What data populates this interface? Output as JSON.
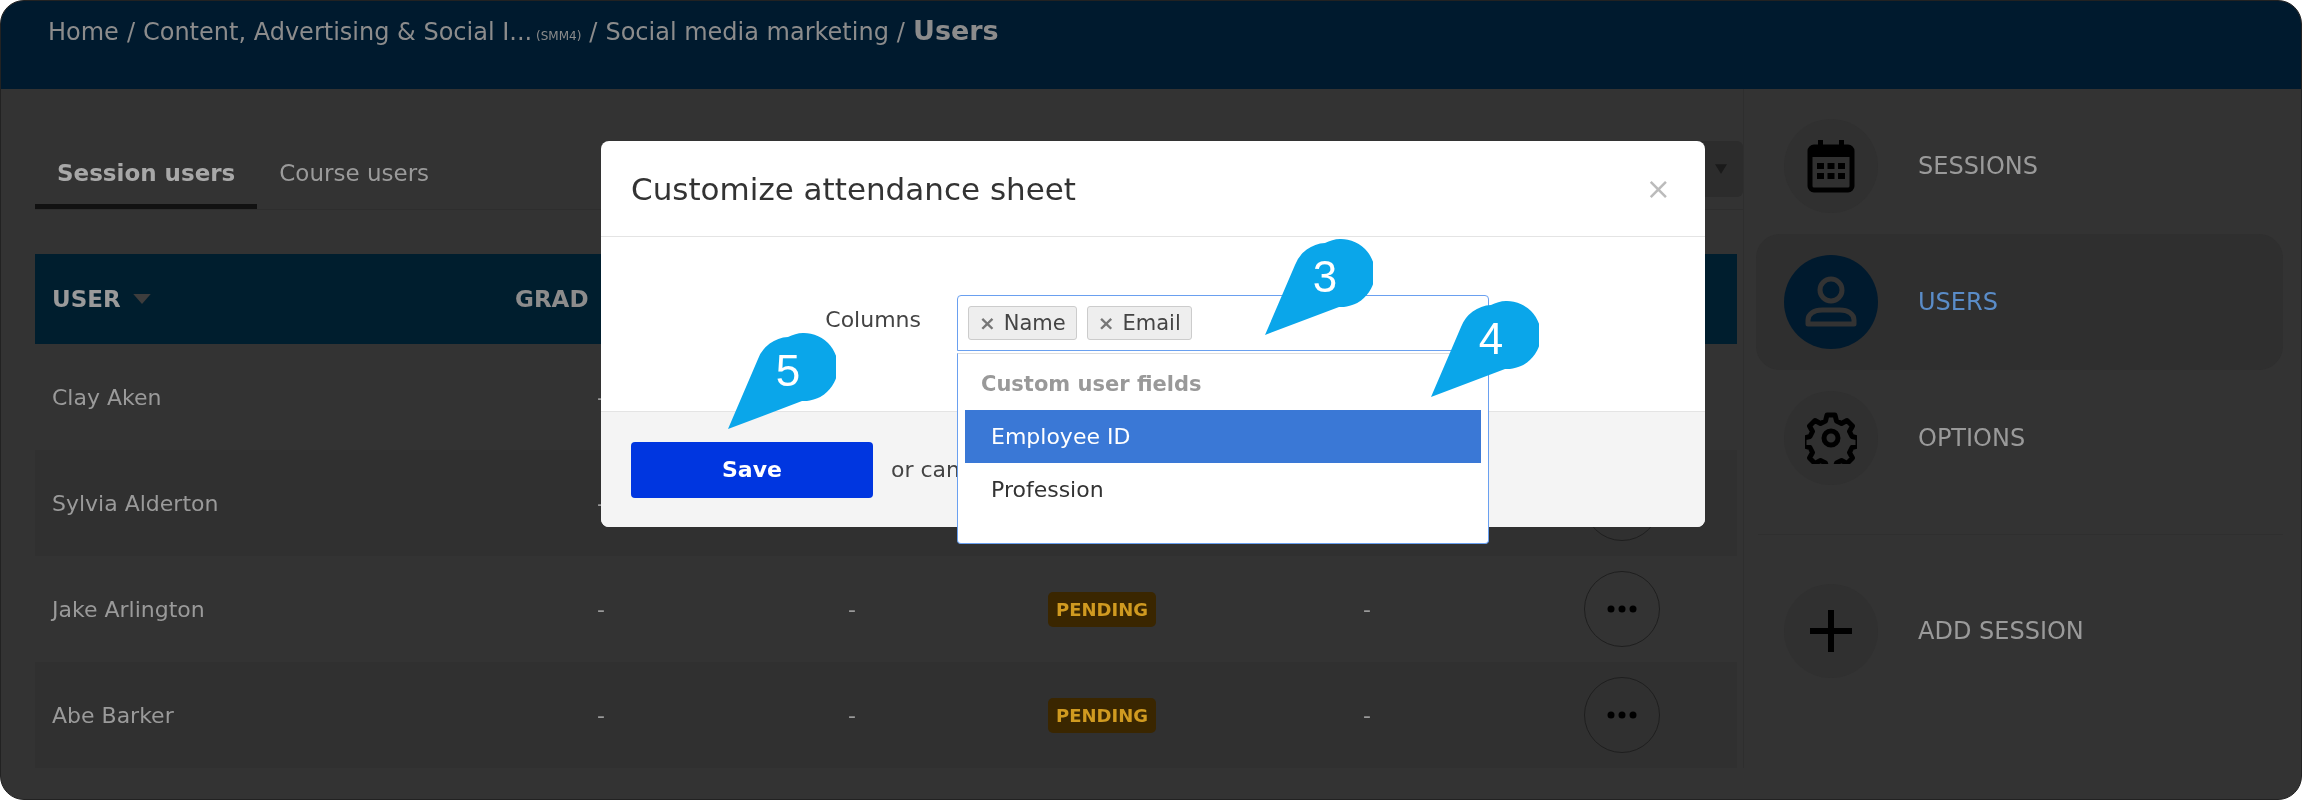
{
  "breadcrumb": {
    "separator": "/",
    "items": [
      {
        "label": "Home"
      },
      {
        "label": "Content, Advertising & Social I...",
        "code": "(SMM4)"
      },
      {
        "label": "Social media marketing"
      }
    ],
    "current": "Users"
  },
  "tabs": [
    {
      "label": "Session users",
      "selected": true
    },
    {
      "label": "Course users",
      "selected": false
    }
  ],
  "table": {
    "columns": [
      {
        "label": "USER",
        "sorted": true
      },
      {
        "label": "GRAD",
        "sorted": false
      }
    ],
    "rows": [
      {
        "name": "Clay Aken",
        "cells": [
          {
            "kind": "text",
            "text": "-"
          }
        ]
      },
      {
        "name": "Sylvia Alderton",
        "cells": [
          {
            "kind": "text",
            "text": "-"
          }
        ],
        "menu": true
      },
      {
        "name": "Jake Arlington",
        "cells": [
          {
            "kind": "text",
            "text": "-"
          },
          {
            "kind": "text",
            "text": "-"
          },
          {
            "kind": "badge",
            "text": "PENDING"
          },
          {
            "kind": "text",
            "text": "-"
          }
        ],
        "menu": true
      },
      {
        "name": "Abe Barker",
        "cells": [
          {
            "kind": "text",
            "text": "-"
          },
          {
            "kind": "text",
            "text": "-"
          },
          {
            "kind": "badge",
            "text": "PENDING"
          },
          {
            "kind": "text",
            "text": "-"
          }
        ],
        "menu": true
      }
    ]
  },
  "sidebar": {
    "items": [
      {
        "kind": "calendar",
        "label": "SESSIONS",
        "selected": false
      },
      {
        "kind": "user",
        "label": "USERS",
        "selected": true
      },
      {
        "kind": "gear",
        "label": "OPTIONS",
        "selected": false
      },
      {
        "kind": "plus",
        "label": "ADD SESSION",
        "selected": false
      }
    ]
  },
  "modal": {
    "title": "Customize attendance sheet",
    "close": "×",
    "field_label": "Columns",
    "tags": [
      {
        "remove": "×",
        "label": "Name"
      },
      {
        "remove": "×",
        "label": "Email"
      }
    ],
    "dropdown": {
      "group": "Custom user fields",
      "options": [
        {
          "label": "Employee ID",
          "selected": true
        },
        {
          "label": "Profession",
          "selected": false
        }
      ]
    },
    "save": "Save",
    "cancel_text": "or can"
  },
  "callouts": [
    {
      "label": "3"
    },
    {
      "label": "4"
    },
    {
      "label": "5"
    }
  ]
}
